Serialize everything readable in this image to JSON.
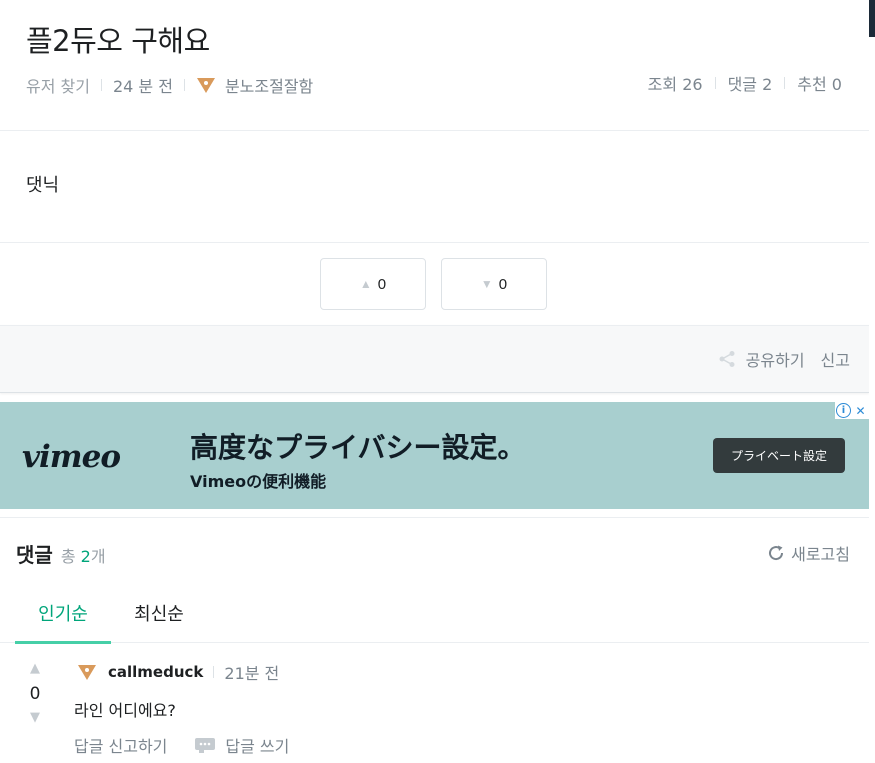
{
  "post": {
    "title": "플2듀오 구해요",
    "category": "유저 찾기",
    "time": "24 분 전",
    "author": "분노조절잘함",
    "stats": {
      "views": "조회 26",
      "comments": "댓글 2",
      "likes": "추천 0"
    },
    "body": "댓닉"
  },
  "votes": {
    "up": "0",
    "down": "0"
  },
  "share": {
    "share_label": "공유하기",
    "report_label": "신고"
  },
  "ad": {
    "logo": "vimeo",
    "headline": "高度なプライバシー設定。",
    "sub": "Vimeoの便利機能",
    "cta": "プライベート設定",
    "info": "i",
    "close": "✕"
  },
  "comments": {
    "title": "댓글",
    "total_prefix": "총 ",
    "total_count": "2",
    "total_suffix": "개",
    "refresh_label": "새로고침",
    "tabs": [
      "인기순",
      "최신순"
    ],
    "items": [
      {
        "author": "callmeduck",
        "time": "21분 전",
        "votes": "0",
        "text": "라인 어디에요?",
        "report_label": "답글 신고하기",
        "reply_label": "답글 쓰기"
      }
    ]
  },
  "colors": {
    "accent": "#46cfa7",
    "accent_text": "#00a57a",
    "tier": "#d99a5b",
    "ad_bg": "#a8cfcf"
  }
}
